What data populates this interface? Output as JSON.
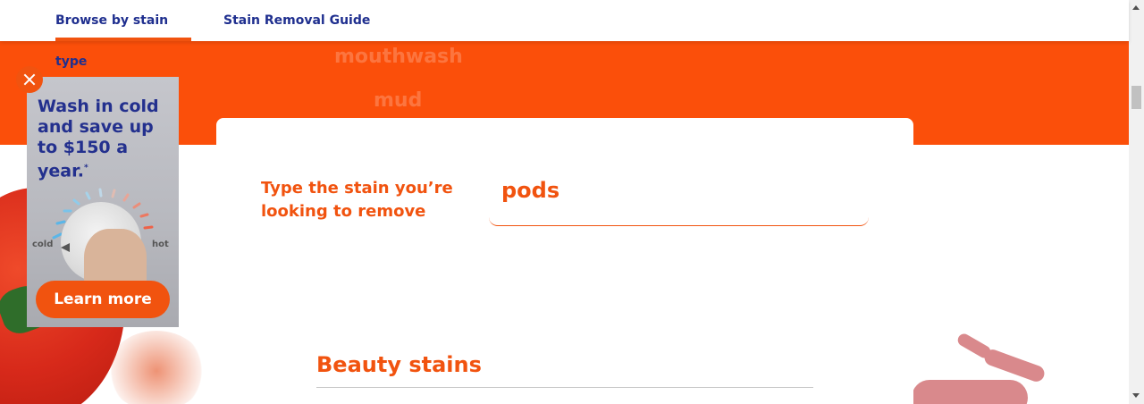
{
  "nav": {
    "tabs": [
      {
        "label": "Browse by stain type"
      },
      {
        "label": "Stain Removal Guide"
      }
    ]
  },
  "hero": {
    "ticker_words": [
      "mouthwash",
      "mud"
    ]
  },
  "search": {
    "prompt": "Type the stain you’re looking to remove",
    "value": "pods"
  },
  "section": {
    "title": "Beauty stains"
  },
  "ad": {
    "headline": "Wash in cold and save up to $150 a year.",
    "footnote_mark": "*",
    "dial_cold_label": "cold",
    "dial_hot_label": "hot",
    "button_label": "Learn more",
    "icons": [
      "close-icon"
    ]
  },
  "colors": {
    "brand_orange": "#fb4f0a",
    "nav_blue": "#1f2f8f"
  }
}
